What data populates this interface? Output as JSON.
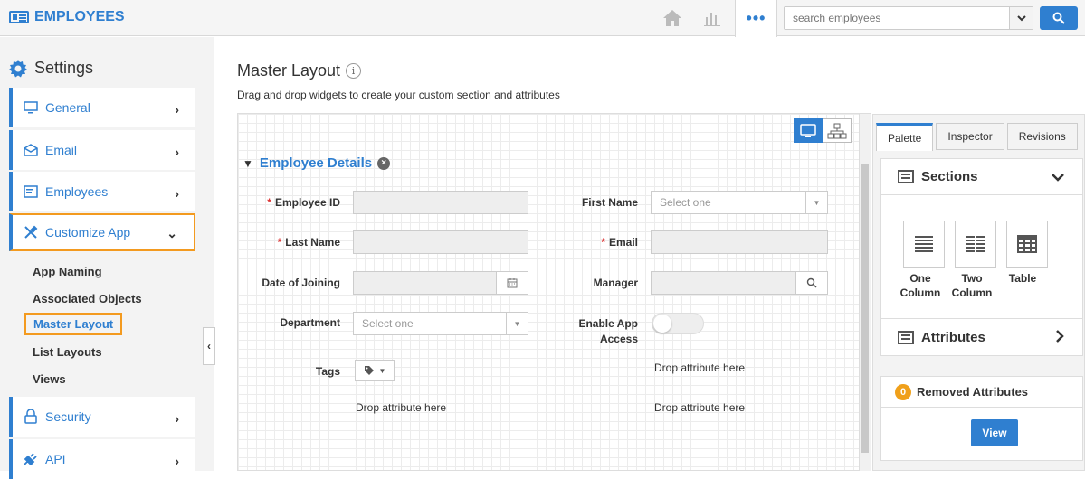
{
  "app": {
    "title": "EMPLOYEES"
  },
  "header": {
    "home_icon": "home-icon",
    "chart_icon": "bar-chart-icon",
    "more_icon": "more-dots-icon",
    "more_label": "•••",
    "search_placeholder": "search employees"
  },
  "sidebar": {
    "title": "Settings",
    "items": [
      {
        "label": "General",
        "icon": "monitor-icon"
      },
      {
        "label": "Email",
        "icon": "envelope-icon"
      },
      {
        "label": "Employees",
        "icon": "list-card-icon"
      },
      {
        "label": "Customize App",
        "icon": "tools-icon"
      },
      {
        "label": "Security",
        "icon": "lock-icon"
      },
      {
        "label": "API",
        "icon": "plug-icon"
      }
    ],
    "sub_items": [
      "App Naming",
      "Associated Objects",
      "Master Layout",
      "List Layouts",
      "Views"
    ],
    "selected_sub": "Master Layout"
  },
  "main": {
    "title": "Master Layout",
    "info_icon": "i",
    "description": "Drag and drop widgets to create your custom section and attributes"
  },
  "section": {
    "title": "Employee Details",
    "close_icon": "×",
    "fields": {
      "employee_id": "Employee ID",
      "first_name": "First Name",
      "first_name_placeholder": "Select one",
      "last_name": "Last Name",
      "email": "Email",
      "date_of_joining": "Date of Joining",
      "manager": "Manager",
      "department": "Department",
      "department_placeholder": "Select one",
      "enable_app_access_1": "Enable App",
      "enable_app_access_2": "Access",
      "tags": "Tags"
    },
    "drop_text": "Drop attribute here"
  },
  "panel": {
    "tabs": [
      "Palette",
      "Inspector",
      "Revisions"
    ],
    "active_tab": "Palette",
    "sections_title": "Sections",
    "widgets": [
      {
        "line1": "One",
        "line2": "Column"
      },
      {
        "line1": "Two",
        "line2": "Column"
      },
      {
        "line1": "Table",
        "line2": ""
      }
    ],
    "attributes_title": "Attributes",
    "removed_title": "Removed Attributes",
    "removed_count": "0",
    "view_label": "View"
  },
  "colors": {
    "accent": "#2f7fd0",
    "highlight": "#f39a1f",
    "badge": "#f0a01a"
  }
}
